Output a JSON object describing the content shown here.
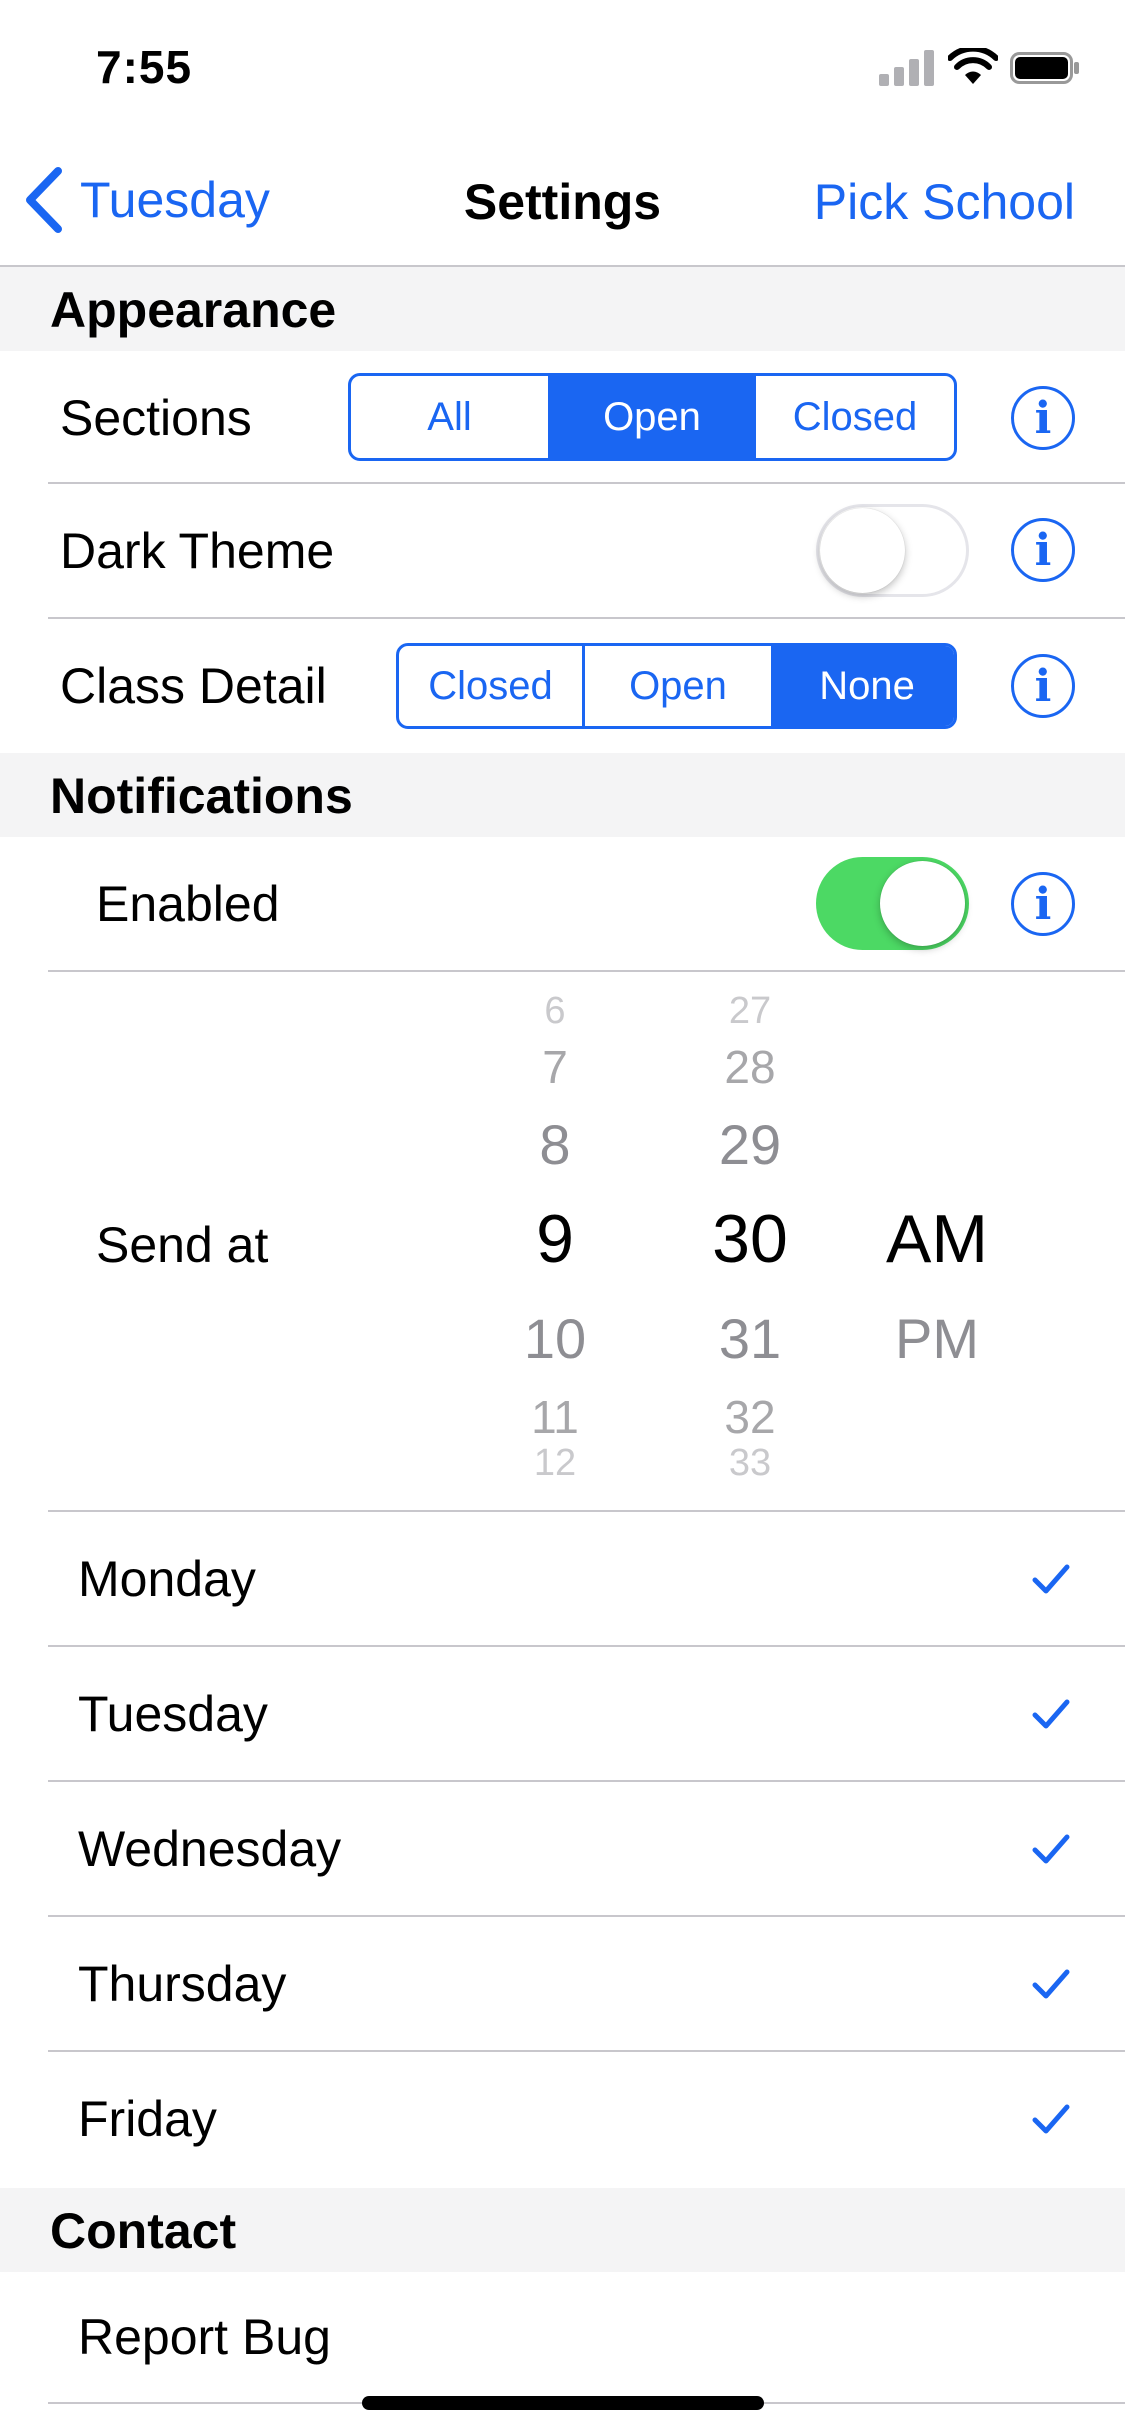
{
  "status_bar": {
    "time": "7:55"
  },
  "nav": {
    "back_label": "Tuesday",
    "title": "Settings",
    "right_button": "Pick School"
  },
  "appearance": {
    "header": "Appearance",
    "sections": {
      "label": "Sections",
      "options": [
        "All",
        "Open",
        "Closed"
      ],
      "selected": "Open"
    },
    "dark_theme": {
      "label": "Dark Theme",
      "enabled": false
    },
    "class_detail": {
      "label": "Class Detail",
      "options": [
        "Closed",
        "Open",
        "None"
      ],
      "selected": "None"
    }
  },
  "notifications": {
    "header": "Notifications",
    "enabled": {
      "label": "Enabled",
      "enabled": true
    },
    "send_at": {
      "label": "Send at",
      "hours": [
        "6",
        "7",
        "8",
        "9",
        "10",
        "11",
        "12"
      ],
      "minutes": [
        "27",
        "28",
        "29",
        "30",
        "31",
        "32",
        "33"
      ],
      "periods": [
        "AM",
        "PM"
      ],
      "selected": {
        "hour": "9",
        "minute": "30",
        "period": "AM"
      }
    },
    "days": [
      {
        "label": "Monday",
        "checked": true
      },
      {
        "label": "Tuesday",
        "checked": true
      },
      {
        "label": "Wednesday",
        "checked": true
      },
      {
        "label": "Thursday",
        "checked": true
      },
      {
        "label": "Friday",
        "checked": true
      }
    ]
  },
  "contact": {
    "header": "Contact",
    "report_bug": "Report Bug"
  },
  "colors": {
    "accent": "#1a66f2",
    "toggle_on": "#4cd964",
    "section_bg": "#f4f4f5"
  }
}
